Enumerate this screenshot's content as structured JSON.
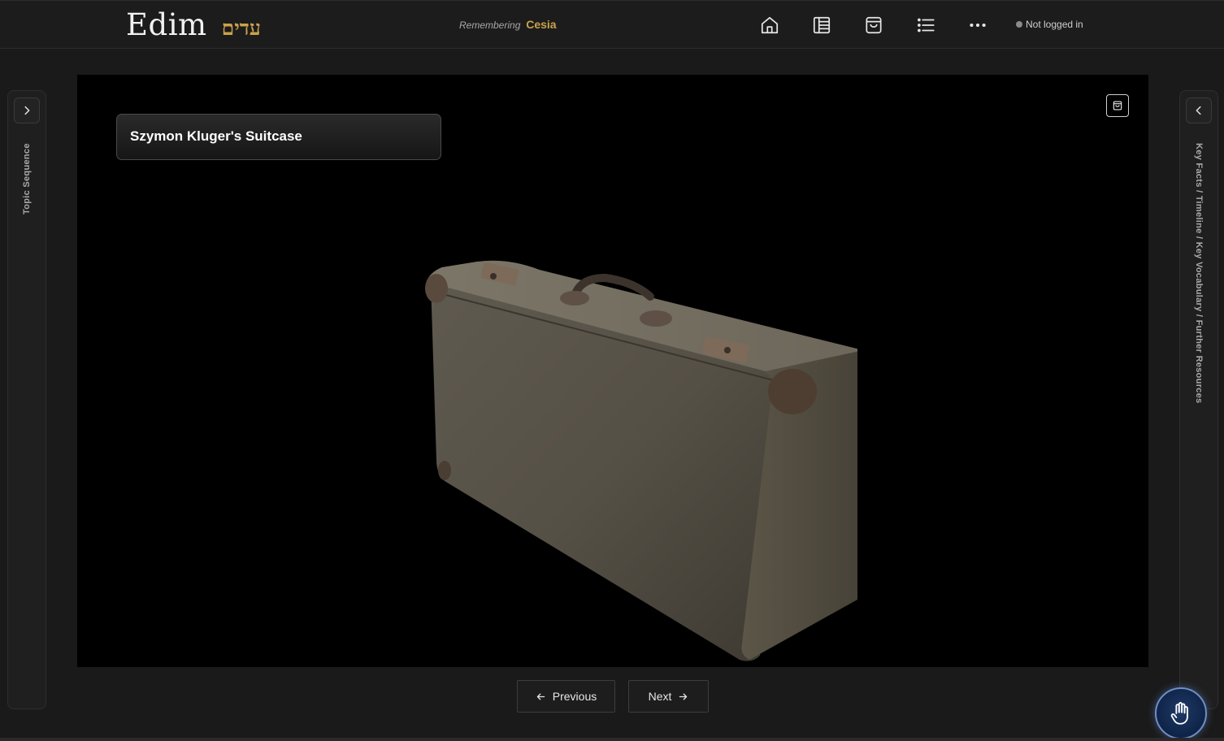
{
  "header": {
    "logo_en": "Edim",
    "logo_he": "עדים",
    "remembering_prefix": "Remembering",
    "remembering_name": "Cesia",
    "nav_icons": [
      "home-icon",
      "book-icon",
      "bag-icon",
      "list-icon",
      "more-icon"
    ],
    "login_status": "Not logged in"
  },
  "left_panel": {
    "label": "Topic Sequence"
  },
  "right_panel": {
    "label": "Key Facts / Timeline / Key Vocabulary / Further Resources"
  },
  "viewer": {
    "title": "Szymon Kluger's Suitcase",
    "image_subject": "suitcase"
  },
  "pager": {
    "previous_label": "Previous",
    "next_label": "Next"
  },
  "colors": {
    "accent": "#c9a24a",
    "background": "#1a1a1a",
    "viewer_bg": "#000000"
  }
}
